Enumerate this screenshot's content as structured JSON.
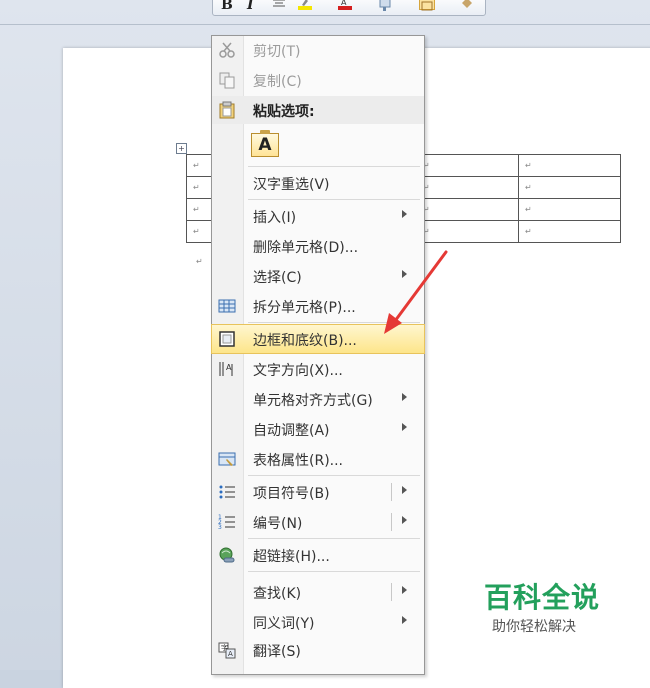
{
  "mini_toolbar": {
    "bold": "B",
    "italic": "I"
  },
  "table": {
    "anchor_icon": "move-table-icon",
    "cell_mark": "↵",
    "rows": [
      [
        "↵",
        "↵",
        "↵",
        "↵",
        "↵"
      ],
      [
        "↵",
        "↵",
        "↵",
        "↵",
        "↵"
      ],
      [
        "↵",
        "↵",
        "↵",
        "↵",
        "↵"
      ],
      [
        "↵",
        "↵",
        "↵",
        "↵",
        "↵"
      ]
    ],
    "after_mark": "↵"
  },
  "context_menu": {
    "cut": "剪切(T)",
    "copy": "复制(C)",
    "paste_header": "粘贴选项:",
    "paste_keep_text": "A",
    "hanzi_reselect": "汉字重选(V)",
    "insert": "插入(I)",
    "delete_cells": "删除单元格(D)...",
    "select": "选择(C)",
    "split_cells": "拆分单元格(P)...",
    "borders_shading": "边框和底纹(B)...",
    "text_direction": "文字方向(X)...",
    "cell_alignment": "单元格对齐方式(G)",
    "autofit": "自动调整(A)",
    "table_properties": "表格属性(R)...",
    "bullets": "项目符号(B)",
    "numbering": "编号(N)",
    "hyperlink": "超链接(H)...",
    "lookup": "查找(K)",
    "synonyms": "同义词(Y)",
    "translate": "翻译(S)"
  },
  "watermark": {
    "title": "百科全说",
    "subtitle": "助你轻松解决"
  },
  "colors": {
    "highlight": "#fde58a",
    "arrow": "#e53935",
    "watermark_green": "#23a05c"
  }
}
